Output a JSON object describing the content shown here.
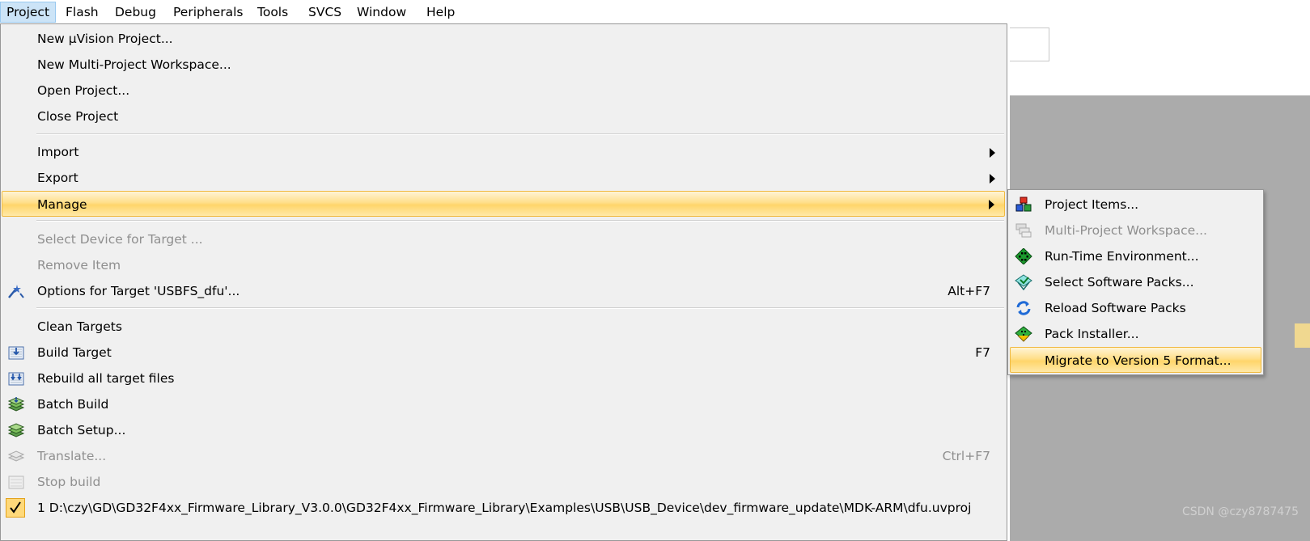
{
  "menubar": [
    "Project",
    "Flash",
    "Debug",
    "Peripherals",
    "Tools",
    "SVCS",
    "Window",
    "Help"
  ],
  "menu": {
    "new_project": "New µVision Project...",
    "new_workspace": "New Multi-Project Workspace...",
    "open_project": "Open Project...",
    "close_project": "Close Project",
    "import": "Import",
    "export": "Export",
    "manage": "Manage",
    "select_device": "Select Device for Target ...",
    "remove_item": "Remove Item",
    "options_target": "Options for Target 'USBFS_dfu'...",
    "options_shortcut": "Alt+F7",
    "clean_targets": "Clean Targets",
    "build_target": "Build Target",
    "build_shortcut": "F7",
    "rebuild_all": "Rebuild all target files",
    "batch_build": "Batch Build",
    "batch_setup": "Batch Setup...",
    "translate": "Translate...",
    "translate_shortcut": "Ctrl+F7",
    "stop_build": "Stop build",
    "recent_project": "1 D:\\czy\\GD\\GD32F4xx_Firmware_Library_V3.0.0\\GD32F4xx_Firmware_Library\\Examples\\USB\\USB_Device\\dev_firmware_update\\MDK-ARM\\dfu.uvproj"
  },
  "submenu": {
    "project_items": "Project Items...",
    "multi_workspace": "Multi-Project Workspace...",
    "runtime_env": "Run-Time Environment...",
    "select_packs": "Select Software Packs...",
    "reload_packs": "Reload Software Packs",
    "pack_installer": "Pack Installer...",
    "migrate": "Migrate to Version 5 Format..."
  },
  "watermark": "CSDN @czy8787475",
  "colors": {
    "highlight": "#ffd56a",
    "menu_bg": "#f0f0f0",
    "open_menu": "#cce4f7",
    "disabled": "#8f8f8f"
  }
}
